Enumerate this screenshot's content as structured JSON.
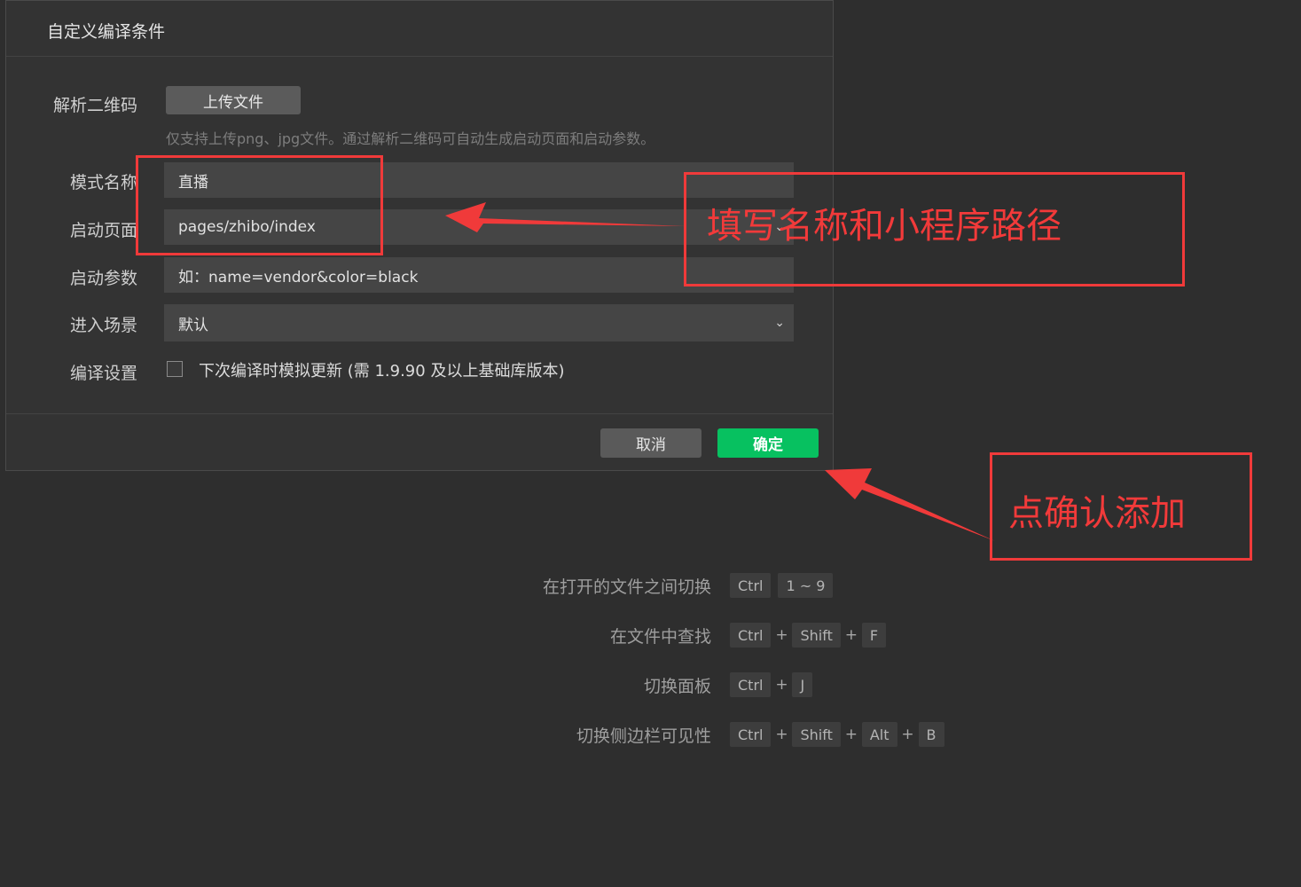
{
  "dialog": {
    "title": "自定义编译条件",
    "qr_label": "解析二维码",
    "upload_button": "上传文件",
    "qr_hint": "仅支持上传png、jpg文件。通过解析二维码可自动生成启动页面和启动参数。",
    "mode_name_label": "模式名称",
    "mode_name_value": "直播",
    "start_page_label": "启动页面",
    "start_page_value": "pages/zhibo/index",
    "start_params_label": "启动参数",
    "start_params_placeholder": "如：name=vendor&color=black",
    "scene_label": "进入场景",
    "scene_value": "默认",
    "compile_label": "编译设置",
    "compile_checkbox_text": "下次编译时模拟更新 (需 1.9.90 及以上基础库版本)",
    "compile_checkbox_checked": false,
    "cancel_button": "取消",
    "ok_button": "确定",
    "ok_color": "#07c160"
  },
  "shortcuts": [
    {
      "label": "在打开的文件之间切换",
      "keys": [
        "Ctrl",
        "1 ~ 9"
      ],
      "separators": [
        ""
      ]
    },
    {
      "label": "在文件中查找",
      "keys": [
        "Ctrl",
        "Shift",
        "F"
      ],
      "separators": [
        "+",
        "+"
      ]
    },
    {
      "label": "切换面板",
      "keys": [
        "Ctrl",
        "J"
      ],
      "separators": [
        "+"
      ]
    },
    {
      "label": "切换侧边栏可见性",
      "keys": [
        "Ctrl",
        "Shift",
        "Alt",
        "B"
      ],
      "separators": [
        "+",
        "+",
        "+"
      ]
    }
  ],
  "annotations": {
    "fill_hint": "填写名称和小程序路径",
    "confirm_hint": "点确认添加",
    "color": "#f03a3a"
  }
}
